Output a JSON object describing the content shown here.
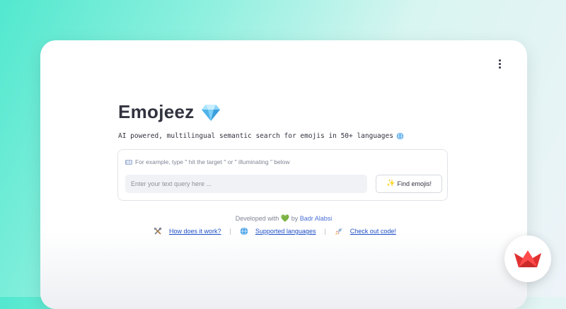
{
  "app": {
    "title": "Emojeez",
    "title_icon": "gem-icon",
    "subtitle": "AI powered, multilingual semantic search for emojis in 50+ languages",
    "subtitle_icon": "globe-icon"
  },
  "form": {
    "hint_icon": "keyboard-icon",
    "hint": "For example, type \" hit the target \" or \" illuminating \" below",
    "input_placeholder": "Enter your text query here ...",
    "input_value": "",
    "button_label": "Find emojis!",
    "button_icon": "sparkles-icon"
  },
  "footer": {
    "credit_prefix": "Developed with",
    "credit_heart": "💚",
    "credit_by": "by",
    "credit_author": "Badr Alabsi",
    "links": [
      {
        "icon": "tools-icon",
        "label": "How does it work?"
      },
      {
        "icon": "globe-icon",
        "label": "Supported languages"
      },
      {
        "icon": "rocket-icon",
        "label": "Check out code!"
      }
    ],
    "separator": "|"
  },
  "colors": {
    "accent_link": "#1f4fc7",
    "text": "#31333f",
    "muted": "#808495",
    "input_bg": "#f0f2f6",
    "streamlit_red": "#ff4b4b"
  }
}
